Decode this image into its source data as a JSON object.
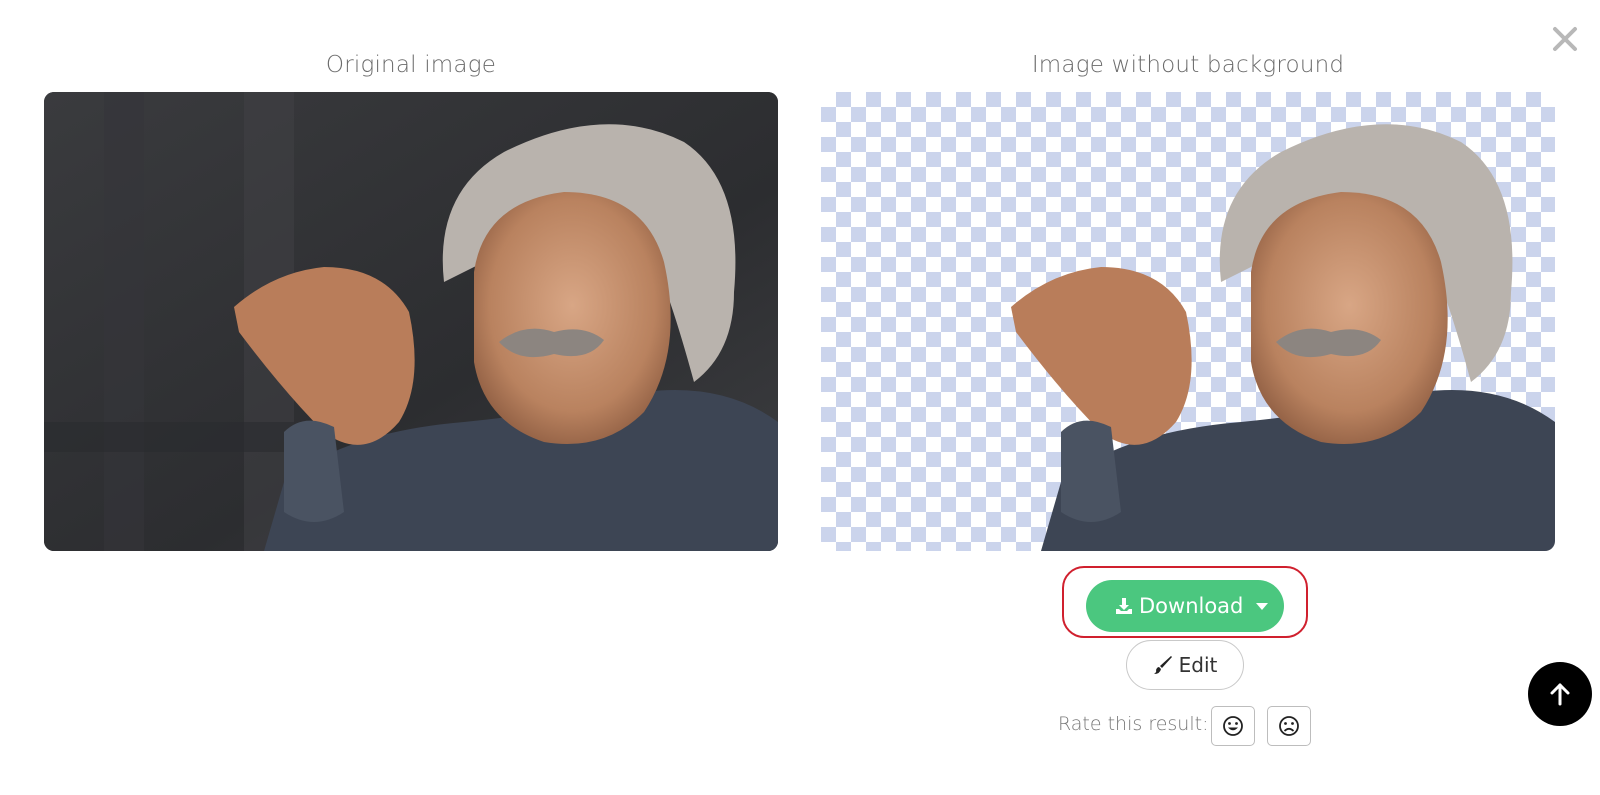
{
  "modal": {
    "original_title": "Original image",
    "result_title": "Image without background"
  },
  "actions": {
    "download_label": "Download",
    "edit_label": "Edit",
    "rate_label": "Rate this result:"
  },
  "icons": {
    "close": "close-icon",
    "download": "download-icon",
    "dropdown": "caret-down-icon",
    "edit": "brush-icon",
    "rate_good": "smile-icon",
    "rate_bad": "frown-icon",
    "scroll_top": "arrow-up-icon"
  },
  "colors": {
    "download_bg": "#4bc77f",
    "highlight_border": "#d0202e",
    "checker": "#cbd4ec"
  }
}
